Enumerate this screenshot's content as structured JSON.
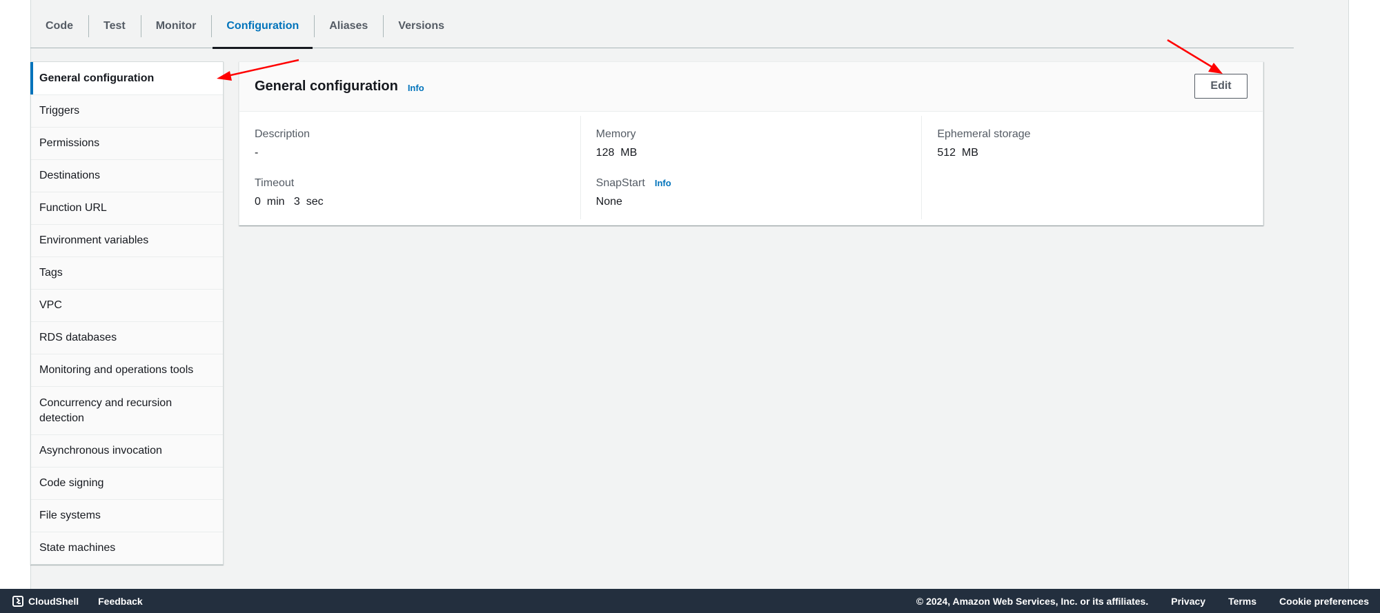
{
  "tabs": [
    {
      "label": "Code",
      "active": false
    },
    {
      "label": "Test",
      "active": false
    },
    {
      "label": "Monitor",
      "active": false
    },
    {
      "label": "Configuration",
      "active": true
    },
    {
      "label": "Aliases",
      "active": false
    },
    {
      "label": "Versions",
      "active": false
    }
  ],
  "sidebar": {
    "items": [
      {
        "label": "General configuration",
        "active": true
      },
      {
        "label": "Triggers"
      },
      {
        "label": "Permissions"
      },
      {
        "label": "Destinations"
      },
      {
        "label": "Function URL"
      },
      {
        "label": "Environment variables"
      },
      {
        "label": "Tags"
      },
      {
        "label": "VPC"
      },
      {
        "label": "RDS databases"
      },
      {
        "label": "Monitoring and operations tools"
      },
      {
        "label": "Concurrency and recursion detection"
      },
      {
        "label": "Asynchronous invocation"
      },
      {
        "label": "Code signing"
      },
      {
        "label": "File systems"
      },
      {
        "label": "State machines"
      }
    ]
  },
  "card": {
    "title": "General configuration",
    "info_label": "Info",
    "edit_label": "Edit",
    "fields": {
      "description": {
        "label": "Description",
        "value": "-"
      },
      "timeout": {
        "label": "Timeout",
        "value": "0  min   3  sec"
      },
      "memory": {
        "label": "Memory",
        "value": "128  MB"
      },
      "snapstart": {
        "label": "SnapStart",
        "info_label": "Info",
        "value": "None"
      },
      "ephemeral_storage": {
        "label": "Ephemeral storage",
        "value": "512  MB"
      }
    }
  },
  "footer": {
    "cloudshell_label": "CloudShell",
    "feedback_label": "Feedback",
    "copyright": "© 2024, Amazon Web Services, Inc. or its affiliates.",
    "privacy_label": "Privacy",
    "terms_label": "Terms",
    "cookie_label": "Cookie preferences"
  },
  "colors": {
    "accent": "#0073bb",
    "annotation_arrow": "#ff0000",
    "footer_bg": "#232f3e",
    "page_bg": "#f2f3f3"
  }
}
